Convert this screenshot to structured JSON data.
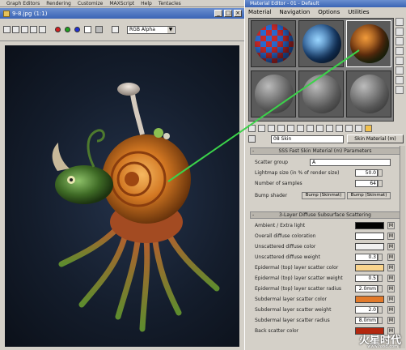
{
  "main_menu": [
    "Graph Editors",
    "Rendering",
    "Customize",
    "MAXScript",
    "Help",
    "Tentacles"
  ],
  "render_frame": {
    "title": "9-8.jpg (1:1)",
    "channel": "RGB Alpha",
    "colors": {
      "red": "#d42020",
      "green": "#1fa11f",
      "blue": "#2030d4"
    }
  },
  "material_editor": {
    "title": "Material Editor - 01 - Default",
    "menu": [
      "Material",
      "Navigation",
      "Options",
      "Utilities"
    ],
    "material_name": "08 Skin",
    "material_type": "Skin Material (m)",
    "rollout_sss": "SSS Fast Skin Material (m) Parameters",
    "scatter_group_label": "Scatter group",
    "scatter_group_value": "A",
    "lightmap_label": "Lightmap size (in % of render size)",
    "lightmap_value": "50.0",
    "samples_label": "Number of samples",
    "samples_value": "64",
    "bump_label": "Bump shader",
    "bump_btn1": "Bump (Skinmat)",
    "bump_btn2": "Bump (Skinmat)",
    "rollout_diffuse": "3-Layer Diffuse Subsurface Scattering",
    "params": [
      {
        "label": "Ambient / Extra light",
        "color": "#000000"
      },
      {
        "label": "Overall diffuse coloration",
        "color": "#ffffff"
      },
      {
        "label": "Unscattered diffuse color",
        "color": "#f1f1f1"
      },
      {
        "label": "Unscattered diffuse weight",
        "value": "0.3"
      },
      {
        "label": "Epidermal (top) layer scatter color",
        "color": "#f9d48d"
      },
      {
        "label": "Epidermal (top) layer scatter weight",
        "value": "0.5"
      },
      {
        "label": "Epidermal (top) layer scatter radius",
        "value": "2.0mm"
      },
      {
        "label": "Subdermal layer scatter color",
        "color": "#e27a2a"
      },
      {
        "label": "Subdermal layer scatter weight",
        "value": "2.0"
      },
      {
        "label": "Subdermal layer scatter radius",
        "value": "8.0mm"
      },
      {
        "label": "Back scatter color",
        "color": "#b3270f"
      }
    ]
  },
  "watermark": {
    "main": "火星时代",
    "sub": "www.hxsd.com"
  }
}
